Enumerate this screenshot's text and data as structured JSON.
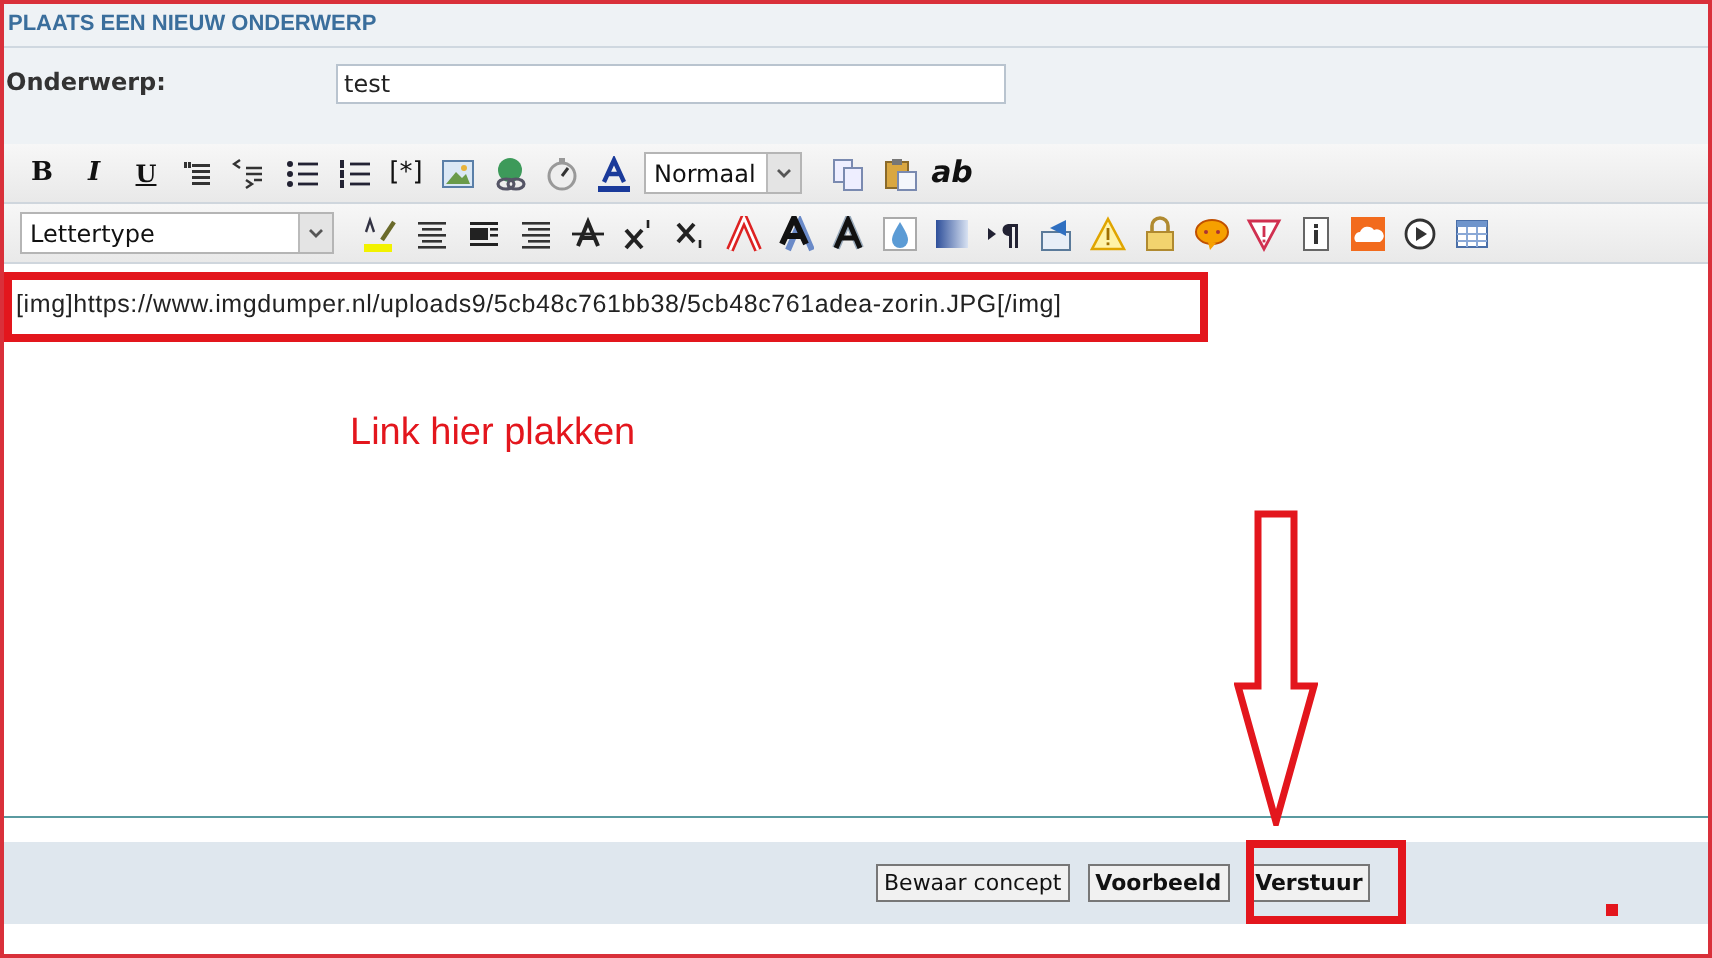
{
  "form": {
    "title": "PLAATS EEN NIEUW ONDERWERP",
    "subject_label": "Onderwerp:",
    "subject_value": "test"
  },
  "toolbar_1": [
    {
      "kind": "text",
      "label": "B"
    },
    {
      "kind": "text",
      "label": "I"
    },
    {
      "kind": "text",
      "label": "U"
    },
    {
      "kind": "icon"
    },
    {
      "kind": "icon"
    },
    {
      "kind": "icon"
    },
    {
      "kind": "icon"
    },
    {
      "kind": "text",
      "label": "[*]"
    },
    {
      "kind": "icon"
    },
    {
      "kind": "icon"
    },
    {
      "kind": "icon"
    },
    {
      "kind": "icon"
    },
    {
      "kind": "select",
      "label": "Normaal"
    },
    {
      "kind": "icon"
    },
    {
      "kind": "icon"
    },
    {
      "kind": "text",
      "label": "ab"
    }
  ],
  "toolbar_2": [
    {
      "kind": "select",
      "label": "Lettertype"
    },
    {
      "kind": "icon"
    },
    {
      "kind": "icon"
    },
    {
      "kind": "icon"
    },
    {
      "kind": "icon"
    },
    {
      "kind": "icon"
    },
    {
      "kind": "icon"
    },
    {
      "kind": "icon"
    },
    {
      "kind": "icon"
    },
    {
      "kind": "icon"
    },
    {
      "kind": "icon"
    },
    {
      "kind": "icon"
    },
    {
      "kind": "icon"
    },
    {
      "kind": "icon"
    },
    {
      "kind": "icon"
    },
    {
      "kind": "icon"
    },
    {
      "kind": "icon"
    },
    {
      "kind": "icon"
    },
    {
      "kind": "icon"
    },
    {
      "kind": "icon"
    },
    {
      "kind": "icon"
    },
    {
      "kind": "icon"
    },
    {
      "kind": "icon"
    }
  ],
  "editor": {
    "value": "[img]https://www.imgdumper.nl/uploads9/5cb48c761bb38/5cb48c761adea-zorin.JPG[/img]"
  },
  "annotation": {
    "note": "Link hier plakken"
  },
  "buttons": [
    {
      "label": "Bewaar concept"
    },
    {
      "label": "Voorbeeld"
    },
    {
      "label": "Verstuur"
    }
  ]
}
